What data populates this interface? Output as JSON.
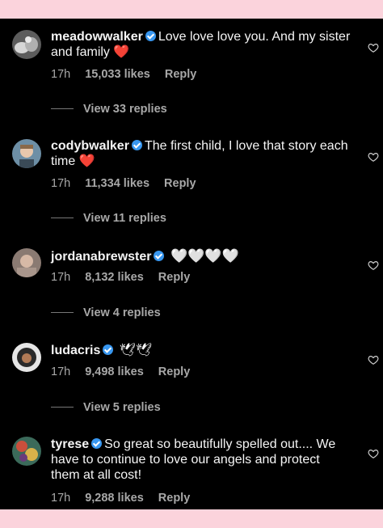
{
  "comments": [
    {
      "username": "meadowwalker",
      "text": "Love love love you. And my sister and family",
      "emoji": "❤️",
      "time": "17h",
      "likes": "15,033 likes",
      "reply": "Reply",
      "view_replies": "View 33 replies"
    },
    {
      "username": "codybwalker",
      "text": "The first child, I love that story each time",
      "emoji": "❤️",
      "time": "17h",
      "likes": "11,334 likes",
      "reply": "Reply",
      "view_replies": "View 11 replies"
    },
    {
      "username": "jordanabrewster",
      "text": "",
      "emoji": "🤍🤍🤍🤍",
      "time": "17h",
      "likes": "8,132 likes",
      "reply": "Reply",
      "view_replies": "View 4 replies"
    },
    {
      "username": "ludacris",
      "text": "",
      "emoji": "🕊🕊",
      "time": "17h",
      "likes": "9,498 likes",
      "reply": "Reply",
      "view_replies": "View 5 replies"
    },
    {
      "username": "tyrese",
      "text": "So great so beautifully spelled out.... We have to continue to love our angels and protect them at all cost!",
      "emoji": "",
      "time": "17h",
      "likes": "9,288 likes",
      "reply": "Reply",
      "view_replies": ""
    }
  ],
  "colors": {
    "background_frame": "#fbd3dc",
    "panel": "#000000",
    "muted_text": "#a8a8a8",
    "verified": "#3897f0",
    "heart_red": "#e4243b"
  },
  "icons": {
    "like": "heart-outline-icon",
    "verified": "verified-badge-icon"
  }
}
